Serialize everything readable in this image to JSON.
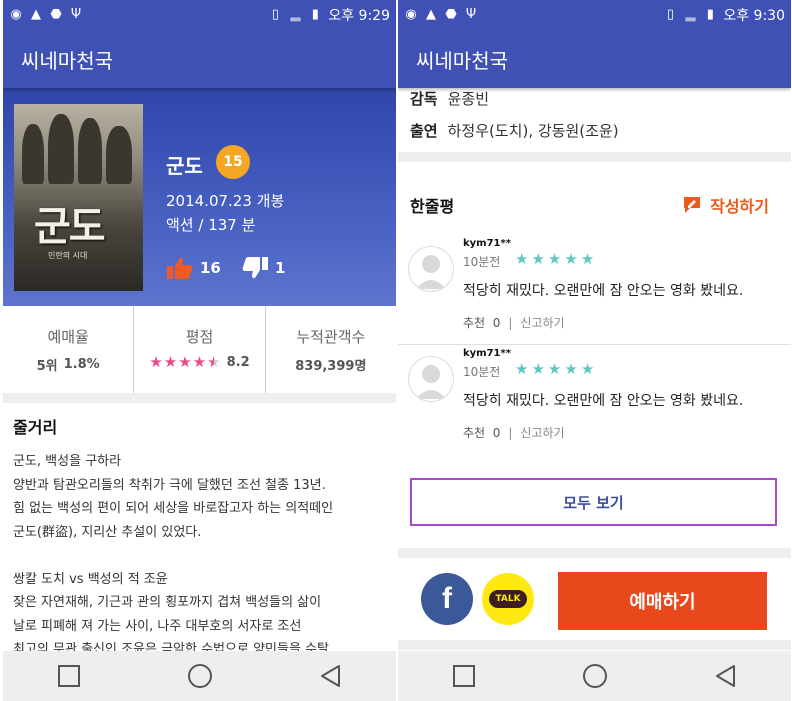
{
  "left": {
    "status": {
      "time": "오후 9:29"
    },
    "app_title": "씨네마천국",
    "movie": {
      "poster_title": "군도",
      "poster_subtitle": "민란의 시대",
      "title": "군도",
      "age_rating": "15",
      "release": "2014.07.23 개봉",
      "genre_runtime": "액션 / 137 분",
      "likes": "16",
      "dislikes": "1"
    },
    "stats": {
      "reservation": {
        "label": "예매율",
        "rank": "5위",
        "rate": "1.8%"
      },
      "rating": {
        "label": "평점",
        "value": "8.2",
        "stars": 4.5
      },
      "audience": {
        "label": "누적관객수",
        "value": "839,399명"
      }
    },
    "synopsis": {
      "heading": "줄거리",
      "body": "군도, 백성을 구하라\n양반과 탐관오리들의 착취가 극에 달했던 조선 철종 13년.\n힘 없는 백성의 편이 되어 세상을 바로잡고자 하는 의적떼인\n군도(群盜), 지리산 추설이 있었다.\n\n쌍칼 도치 vs 백성의 적 조윤\n잦은 자연재해, 기근과 관의 횡포까지 겹쳐 백성들의 삶이\n날로 피폐해 져 가는 사이, 나주 대부호의 서자로 조선\n최고의 무관 출신인 조윤은 극악한 수법으로 양민들을 수탈,"
    }
  },
  "right": {
    "status": {
      "time": "오후 9:30"
    },
    "app_title": "씨네마천국",
    "credits": [
      {
        "label": "감독",
        "value": "윤종빈"
      },
      {
        "label": "출연",
        "value": "하정우(도치), 강동원(조윤)"
      }
    ],
    "reviews_title": "한줄평",
    "write_label": "작성하기",
    "reviews": [
      {
        "user": "kym71**",
        "time": "10분전",
        "stars": 5,
        "text": "적당히 재밌다. 오랜만에 잠 안오는 영화 봤네요.",
        "recommend_label": "추천",
        "recommend_count": "0",
        "report_label": "신고하기"
      },
      {
        "user": "kym71**",
        "time": "10분전",
        "stars": 5,
        "text": "적당히 재밌다. 오랜만에 잠 안오는 영화 봤네요.",
        "recommend_label": "추천",
        "recommend_count": "0",
        "report_label": "신고하기"
      }
    ],
    "view_all": "모두 보기",
    "kakao_label": "TALK",
    "facebook_label": "f",
    "book_button": "예매하기"
  },
  "colors": {
    "primary": "#3f51b5",
    "accent": "#e8481b",
    "like": "#f15a24",
    "star_pink": "#e84a8a",
    "star_teal": "#5ec8c0",
    "age_badge": "#f5a623"
  },
  "icons": [
    "status-app-icon",
    "warning-icon",
    "android-icon",
    "usb-icon",
    "vibrate-icon",
    "signal-icon",
    "battery-icon",
    "thumbs-up-icon",
    "thumbs-down-icon",
    "pencil-icon",
    "avatar-icon",
    "star-icon",
    "square-nav-icon",
    "circle-nav-icon",
    "back-nav-icon"
  ]
}
